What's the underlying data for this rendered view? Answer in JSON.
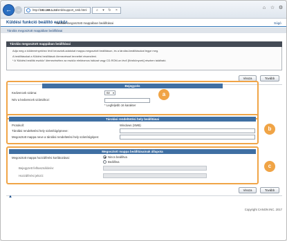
{
  "browser": {
    "address_prefix": "http://",
    "address_host": "192.168.1.24",
    "address_path": "/smb/support_smb.html"
  },
  "header": {
    "app_title": "Küldési funkció beállító eszköz",
    "page_name": "Tárolás megosztott mappában beállításai",
    "header_link": "Súgó"
  },
  "breadcrumb": "Tárolás megosztott mappában beállításai",
  "panel": {
    "title": "Tárolás megosztott mappában beállításai",
    "notes": [
      "Adja meg a küldeményekhez lévő beosztott-adatokat mappa-megosztott beállításon, és a tárolási-beállításokat tegye meg.",
      "A beállításokat a Küldési beállítások ütemezéssel tennettel részesíteni.",
      "* A 'Küldési beállító eszköz' ütemezéséhez az eszköz elektromos hálózat vagy CD-ROM-on lévő [Kézikönyvek] részben található.",
      "* Ha egy egyszerűsítés beállítást választanak ki, ütemezésként hozzá lehet tenni a [Kézikönyvek] részhez."
    ]
  },
  "buttons": {
    "next": "Tovább",
    "back": "Vissza"
  },
  "registration": {
    "title": "Bejegyzés",
    "fav_number_label": "Kedvencek száma:",
    "fav_number_value": "02",
    "fav_name_label": "Név a kedvencek számához:",
    "fav_name_value": "",
    "fav_name_hint": "* Legfeljebb 16 karakter",
    "badge": "a"
  },
  "destination": {
    "title": "Tárolási rendeltetési hely beállításai",
    "protocol_label": "Protokoll:",
    "protocol_value": "Windows (SMB)",
    "host_label": "Tárolási rendeltetési hely számítógépneve:",
    "host_value": "",
    "path_label": "Megosztott mappa neve a tárolási rendeltetési hely számítógépen:",
    "path_value": "",
    "badge": "b"
  },
  "access": {
    "title": "Megosztott mappa beállításainak állapota",
    "setting_label": "Megosztott mappa hozzáférési korlátozásai:",
    "option_off": "Nincs beállítva",
    "option_on": "Beállítva",
    "selected": "Nincs beállítva",
    "user_label": "Bejegyzett felhasználónév:",
    "user_value": "",
    "password_label": "Hozzáférési jelszó:",
    "password_value": "",
    "badge": "c"
  },
  "footer": {
    "top_link": "▲",
    "copyright": "Copyright CANON INC. 2017"
  },
  "colors": {
    "section_border": "#f0a446",
    "section_header": "#3f6fa3",
    "panel_header": "#444b55",
    "link": "#1a4f8c"
  }
}
